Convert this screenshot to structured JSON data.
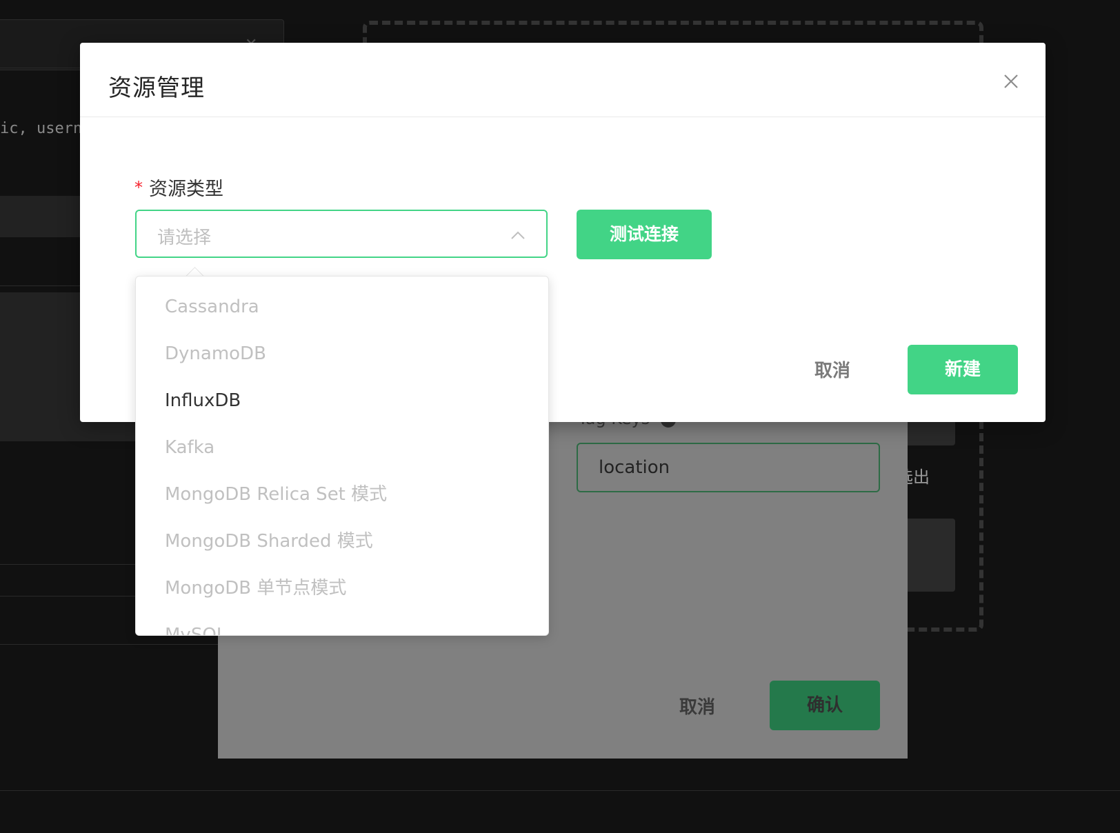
{
  "background": {
    "code_snippet": "ic, usern",
    "dashed_text": "选出",
    "underlying_dialog": {
      "tag_keys_label": "Tag Keys",
      "tag_keys_value": "location",
      "cancel_label": "取消",
      "confirm_label": "确认"
    }
  },
  "modal": {
    "title": "资源管理",
    "form": {
      "required_mark": "*",
      "resource_type_label": "资源类型",
      "select_placeholder": "请选择"
    },
    "test_connection_label": "测试连接",
    "footer": {
      "cancel_label": "取消",
      "create_label": "新建"
    }
  },
  "dropdown": {
    "options": [
      "Cassandra",
      "DynamoDB",
      "InfluxDB",
      "Kafka",
      "MongoDB Relica Set 模式",
      "MongoDB Sharded 模式",
      "MongoDB 单节点模式",
      "MySQL"
    ],
    "active_index": 2
  },
  "colors": {
    "primary": "#42d486",
    "placeholder": "#bfbfbf",
    "disabled_option": "#c0c0c0",
    "required": "#f5222d",
    "overlay": "#111111"
  }
}
